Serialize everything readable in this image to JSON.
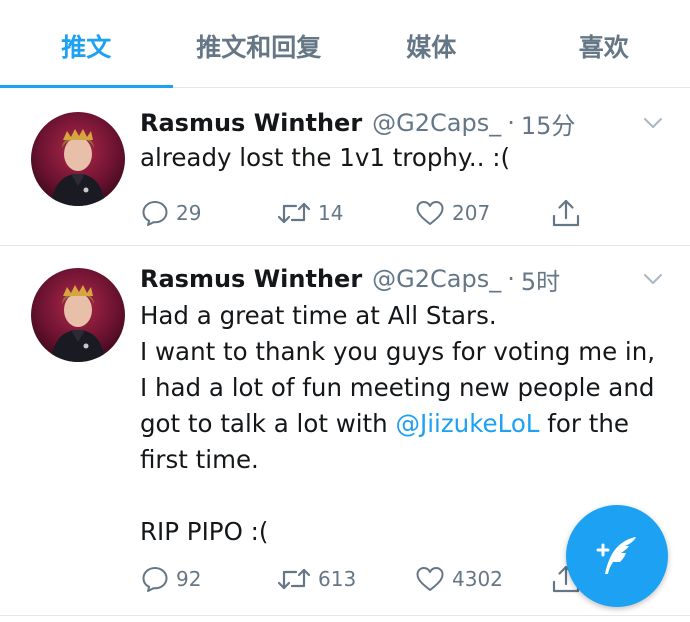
{
  "tabs": [
    {
      "label": "推文",
      "active": true
    },
    {
      "label": "推文和回复",
      "active": false
    },
    {
      "label": "媒体",
      "active": false
    },
    {
      "label": "喜欢",
      "active": false
    }
  ],
  "tweets": [
    {
      "name": "Rasmus Winther",
      "handle": "@G2Caps_",
      "separator": "·",
      "time": "15分",
      "lines": [
        "already lost the 1v1 trophy.. :("
      ],
      "replies": "29",
      "retweets": "14",
      "likes": "207"
    },
    {
      "name": "Rasmus Winther",
      "handle": "@G2Caps_",
      "separator": "·",
      "time": "5时",
      "lines": [
        "Had a great time at All Stars.",
        "I want to thank you guys for voting me in,",
        "I had a lot of fun meeting new people and",
        "got to talk a lot with ",
        "first time.",
        "RIP PIPO :("
      ],
      "mention": "@JiizukeLoL",
      "mention_after": " for the",
      "replies": "92",
      "retweets": "613",
      "likes": "4302"
    }
  ],
  "colors": {
    "accent": "#1da1f2",
    "muted": "#657786",
    "text": "#14171a"
  },
  "icons": [
    "reply-icon",
    "retweet-icon",
    "like-icon",
    "share-icon",
    "caret-down-icon",
    "compose-icon"
  ]
}
